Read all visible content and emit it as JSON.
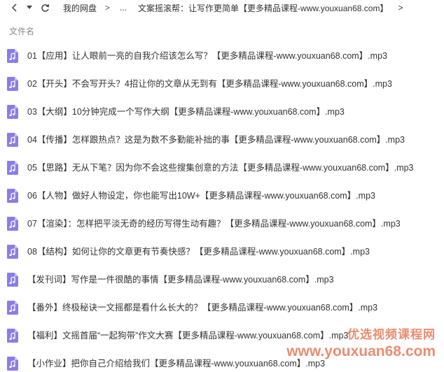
{
  "nav": {
    "home": "我的网盘",
    "ellipsis": "...",
    "current": "文案摇滚帮：让写作更简单【更多精品课程-www.youxuan68.com】",
    "sep": ">",
    "sep_end": ">"
  },
  "list": {
    "column_header": "文件名",
    "files": [
      "01【应用】让人眼前一亮的自我介绍该怎么写？【更多精品课程-www.youxuan68.com】.mp3",
      "02【开头】不会写开头？4招让你的文章从无到有【更多精品课程-www.youxuan68.com】.mp3",
      "03【大纲】10分钟完成一个写作大纲【更多精品课程-www.youxuan68.com】.mp3",
      "04【传播】怎样跟热点？这是为数不多勤能补拙的事【更多精品课程-www.youxuan68.com】.mp3",
      "05【思路】无从下笔？因为你不会这些搜集创意的方法【更多精品课程-www.youxuan68.com】.mp3",
      "06【人物】做好人物设定，你也能写出10W+【更多精品课程-www.youxuan68.com】.mp3",
      "07【渲染】：怎样把平淡无奇的经历写得生动有趣？【更多精品课程-www.youxuan68.com】.mp3",
      "08【结构】如何让你的文章更有节奏快感？【更多精品课程-www.youxuan68.com】.mp3",
      "【发刊词】写作是一件很酷的事情【更多精品课程-www.youxuan68.com】.mp3",
      "【番外】终极秘诀一文摇都是看什么长大的？【更多精品课程-www.youxuan68.com】.mp3",
      "【福利】文摇首届“一起狗带”作文大赛【更多精品课程-www.youxuan68.com】.mp3",
      "【小作业】把你自己介绍给我们【更多精品课程-www.youxuan68.com】.mp3"
    ]
  },
  "watermark": {
    "title": "优选视频课程网",
    "url": "www.youxuan68.com"
  },
  "colors": {
    "file_icon": "#8a7de8",
    "watermark": "#e57a58"
  },
  "icons": {
    "back": "chevron-left-icon",
    "dropdown": "caret-down-icon",
    "refresh": "refresh-icon",
    "file": "music-file-icon"
  }
}
